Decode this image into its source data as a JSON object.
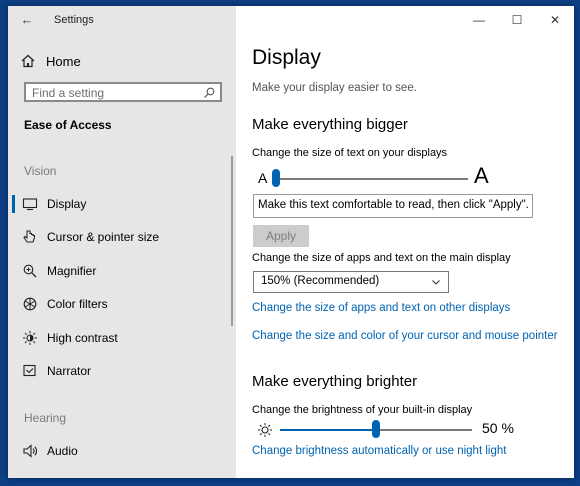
{
  "app": {
    "title": "Settings",
    "back_glyph": "←",
    "controls": {
      "minimize": "—",
      "maximize": "☐",
      "close": "✕"
    }
  },
  "sidebar": {
    "home_label": "Home",
    "home_icon": "home-icon",
    "search_placeholder": "Find a setting",
    "search_icon": "search-icon",
    "section_title": "Ease of Access",
    "groups": [
      {
        "label": "Vision",
        "items": [
          {
            "label": "Display",
            "icon": "monitor-icon",
            "active": true
          },
          {
            "label": "Cursor & pointer size",
            "icon": "cursor-icon",
            "active": false
          },
          {
            "label": "Magnifier",
            "icon": "magnifier-icon",
            "active": false
          },
          {
            "label": "Color filters",
            "icon": "color-filter-icon",
            "active": false
          },
          {
            "label": "High contrast",
            "icon": "high-contrast-icon",
            "active": false
          },
          {
            "label": "Narrator",
            "icon": "narrator-icon",
            "active": false
          }
        ]
      },
      {
        "label": "Hearing",
        "items": [
          {
            "label": "Audio",
            "icon": "speaker-icon",
            "active": false
          }
        ]
      }
    ]
  },
  "main": {
    "title": "Display",
    "subtitle": "Make your display easier to see.",
    "bigger": {
      "heading": "Make everything bigger",
      "text_size_label": "Change the size of text on your displays",
      "slider_small_glyph": "A",
      "slider_large_glyph": "A",
      "text_size_level": 0.0,
      "preview_text": "Make this text comfortable to read, then click \"Apply\".",
      "apply_label": "Apply",
      "scale_label": "Change the size of apps and text on the main display",
      "scale_value": "150% (Recommended)",
      "link_other_displays": "Change the size of apps and text on other displays",
      "link_cursor": "Change the size and color of your cursor and mouse pointer"
    },
    "brighter": {
      "heading": "Make everything brighter",
      "brightness_label": "Change the brightness of your built-in display",
      "brightness_level": 0.5,
      "brightness_value": "50 %",
      "link_night_light": "Change brightness automatically or use night light"
    }
  },
  "colors": {
    "accent": "#0063b1",
    "sidebar_bg": "#e6e6e6",
    "desktop_bg": "#0d3f86"
  }
}
